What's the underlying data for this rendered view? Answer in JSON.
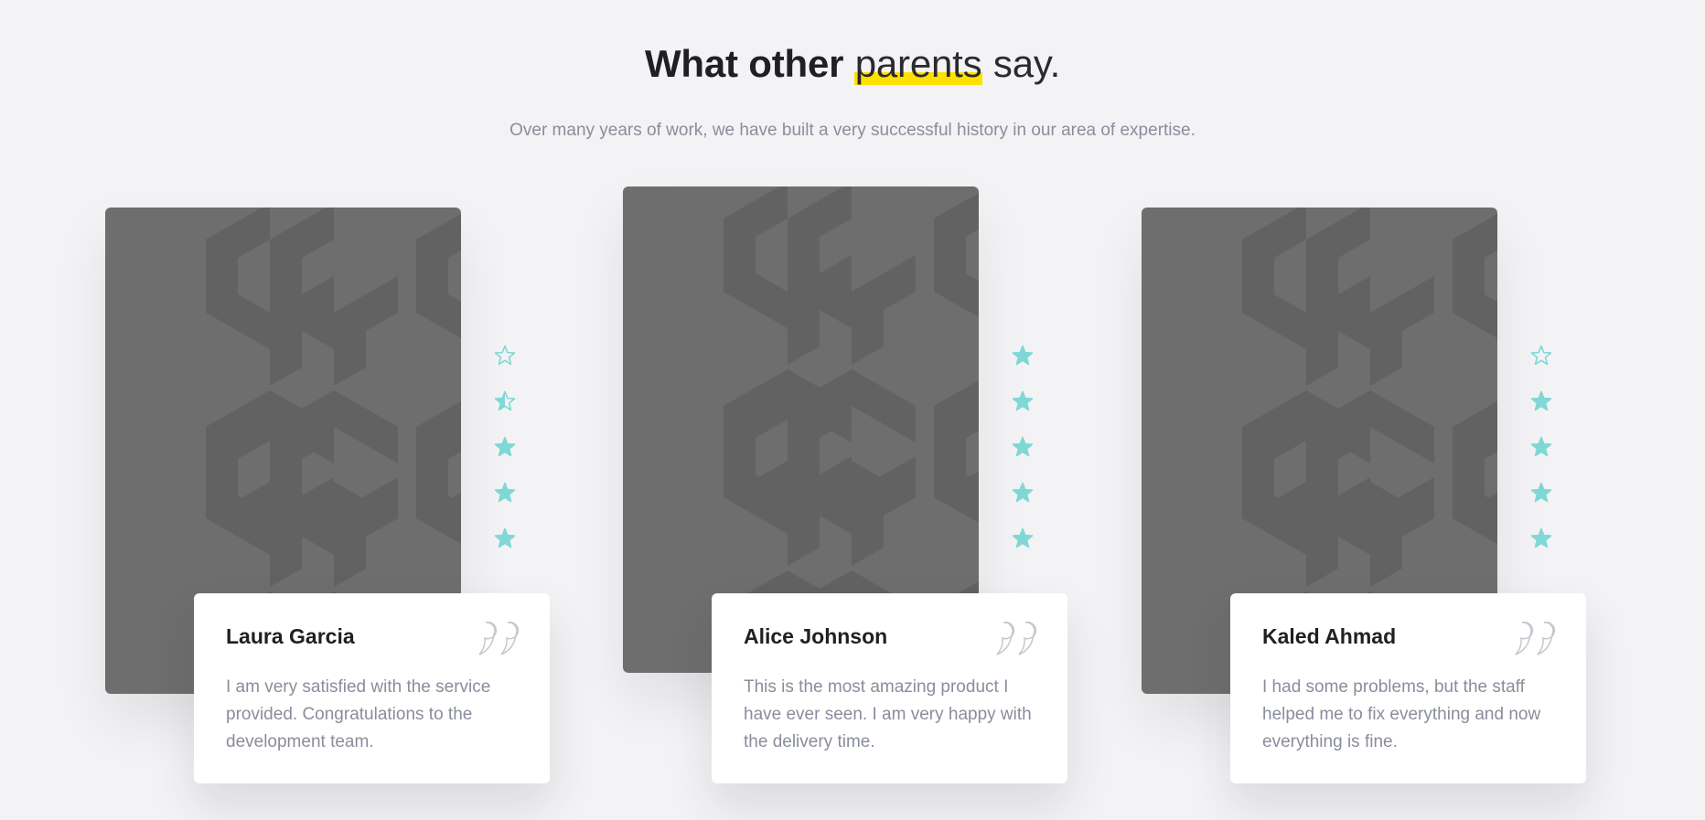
{
  "heading": {
    "part_bold": "What other",
    "part_highlight": "parents",
    "part_light": "say.",
    "highlight_color": "#ffe000"
  },
  "subtitle": "Over many years of work, we have built a very successful history in our area of expertise.",
  "colors": {
    "background": "#f3f3f5",
    "photo_placeholder": "#6e6e6e",
    "star": "#7fd8d6",
    "muted_text": "#8a8d9c"
  },
  "testimonials": [
    {
      "name": "Laura Garcia",
      "text": "I am very satisfied with the service provided. Congratulations to the development team.",
      "rating": 3.5,
      "rating_max": 5,
      "quote_icon": "quote-icon",
      "photo": "image-placeholder"
    },
    {
      "name": "Alice Johnson",
      "text": "This is the most amazing product I have ever seen. I am very happy with the delivery time.",
      "rating": 5,
      "rating_max": 5,
      "quote_icon": "quote-icon",
      "photo": "image-placeholder"
    },
    {
      "name": "Kaled Ahmad",
      "text": "I had some problems, but the staff helped me to fix everything and now everything is fine.",
      "rating": 4,
      "rating_max": 5,
      "quote_icon": "quote-icon",
      "photo": "image-placeholder"
    }
  ]
}
